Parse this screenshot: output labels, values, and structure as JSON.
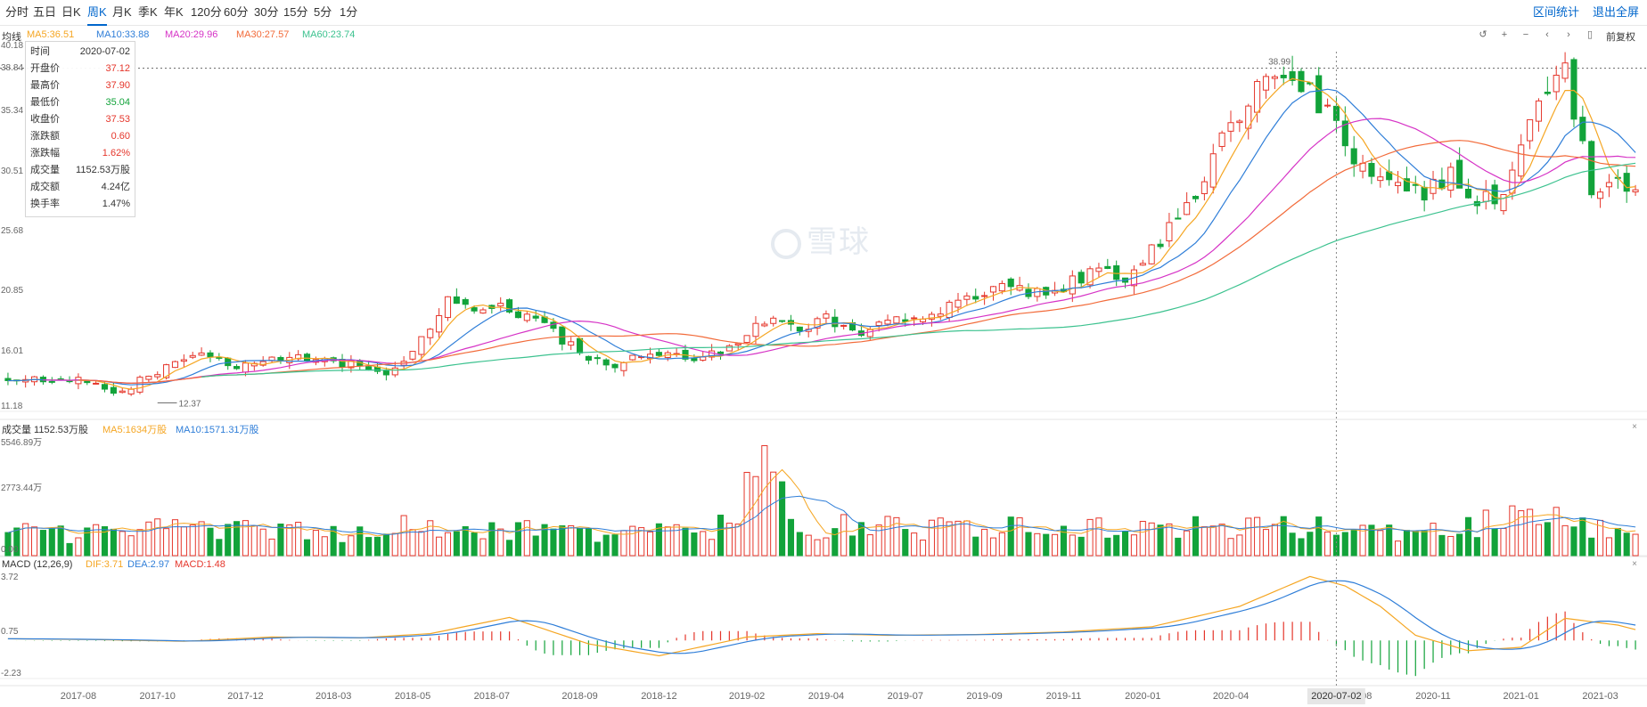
{
  "tabs": [
    {
      "label": "分时",
      "active": false
    },
    {
      "label": "五日",
      "active": false
    },
    {
      "label": "日K",
      "active": false
    },
    {
      "label": "周K",
      "active": true
    },
    {
      "label": "月K",
      "active": false
    },
    {
      "label": "季K",
      "active": false
    },
    {
      "label": "年K",
      "active": false
    },
    {
      "label": "120分",
      "active": false
    },
    {
      "label": "60分",
      "active": false
    },
    {
      "label": "30分",
      "active": false
    },
    {
      "label": "15分",
      "active": false
    },
    {
      "label": "5分",
      "active": false
    },
    {
      "label": "1分",
      "active": false
    }
  ],
  "top_links": {
    "range_stats": "区间统计",
    "exit_fullscreen": "退出全屏"
  },
  "price_legend": {
    "title": "均线",
    "items": [
      {
        "text": "MA5:36.51",
        "color": "#f5a623"
      },
      {
        "text": "MA10:33.88",
        "color": "#2f7ed8"
      },
      {
        "text": "MA20:29.96",
        "color": "#d633c6"
      },
      {
        "text": "MA30:27.57",
        "color": "#f26b3a"
      },
      {
        "text": "MA60:23.74",
        "color": "#3cc28f"
      }
    ]
  },
  "adjust_label": "前复权",
  "controls": [
    "left-right-icon",
    "zoom-in-icon",
    "zoom-out-icon",
    "prev-icon",
    "next-icon",
    "pause-icon"
  ],
  "tooltip": {
    "rows": [
      {
        "k": "时间",
        "v": "2020-07-02",
        "color": "#333333"
      },
      {
        "k": "开盘价",
        "v": "37.12",
        "color": "#e5362b"
      },
      {
        "k": "最高价",
        "v": "37.90",
        "color": "#e5362b"
      },
      {
        "k": "最低价",
        "v": "35.04",
        "color": "#12a33a"
      },
      {
        "k": "收盘价",
        "v": "37.53",
        "color": "#e5362b"
      },
      {
        "k": "涨跌额",
        "v": "0.60",
        "color": "#e5362b"
      },
      {
        "k": "涨跌幅",
        "v": "1.62%",
        "color": "#e5362b"
      },
      {
        "k": "成交量",
        "v": "1152.53万股",
        "color": "#333333"
      },
      {
        "k": "成交额",
        "v": "4.24亿",
        "color": "#333333"
      },
      {
        "k": "换手率",
        "v": "1.47%",
        "color": "#333333"
      }
    ]
  },
  "volume_legend": {
    "items": [
      {
        "text": "成交量 1152.53万股",
        "color": "#333333"
      },
      {
        "text": "MA5:1634万股",
        "color": "#f5a623"
      },
      {
        "text": "MA10:1571.31万股",
        "color": "#2f7ed8"
      }
    ]
  },
  "macd_legend": {
    "items": [
      {
        "text": "MACD (12,26,9)",
        "color": "#333333"
      },
      {
        "text": "DIF:3.71",
        "color": "#f5a623"
      },
      {
        "text": "DEA:2.97",
        "color": "#2f7ed8"
      },
      {
        "text": "MACD:1.48",
        "color": "#e5362b"
      }
    ]
  },
  "watermark": "雪球",
  "x_cursor_label": "2020-07-02",
  "chart_data": {
    "type": "candlestick",
    "colors": {
      "up": "#e5362b",
      "down": "#12a33a",
      "ma5": "#f5a623",
      "ma10": "#2f7ed8",
      "ma20": "#d633c6",
      "ma30": "#f26b3a",
      "ma60": "#3cc28f"
    },
    "x_labels": [
      "2017-08",
      "2017-10",
      "2017-12",
      "2018-03",
      "2018-05",
      "2018-07",
      "2018-09",
      "2018-12",
      "2019-02",
      "2019-04",
      "2019-07",
      "2019-09",
      "2019-11",
      "2020-01",
      "2020-04",
      "2020-08",
      "2020-11",
      "2021-01",
      "2021-03"
    ],
    "x_label_index": [
      8,
      17,
      27,
      37,
      46,
      55,
      65,
      74,
      84,
      93,
      102,
      111,
      120,
      129,
      139,
      153,
      162,
      172,
      181
    ],
    "price_axis": {
      "labels": [
        "40.18",
        "38.84",
        "35.34",
        "30.51",
        "25.68",
        "20.85",
        "16.01",
        "11.18"
      ],
      "ylim": [
        11.18,
        40.18
      ]
    },
    "annotations": [
      {
        "text": "38.99",
        "note": "period high"
      },
      {
        "text": "12.37",
        "note": "period low"
      }
    ],
    "volume_axis": {
      "labels": [
        "5546.89万",
        "2773.44万",
        "0.00"
      ],
      "ylim": [
        0,
        5546.89
      ]
    },
    "macd_axis": {
      "labels": [
        "3.72",
        "0.75",
        "-2.23"
      ],
      "ylim": [
        -2.23,
        3.72
      ]
    },
    "anchors": {
      "close_idx": [
        0,
        6,
        10,
        12,
        17,
        21,
        27,
        32,
        38,
        43,
        46,
        50,
        53,
        56,
        60,
        64,
        68,
        73,
        79,
        83,
        86,
        89,
        93,
        97,
        101,
        106,
        109,
        112,
        116,
        120,
        124,
        127,
        131,
        135,
        139,
        143,
        147,
        150,
        153,
        157,
        161,
        164,
        167,
        170,
        174,
        177,
        180,
        185
      ],
      "close_val": [
        13.4,
        14.0,
        13.2,
        12.6,
        14.3,
        15.7,
        14.8,
        15.6,
        15.0,
        14.4,
        16.2,
        20.2,
        19.0,
        19.6,
        18.4,
        16.5,
        14.6,
        15.9,
        15.4,
        17.0,
        18.6,
        17.8,
        18.6,
        17.4,
        18.6,
        19.2,
        20.3,
        21.2,
        20.7,
        21.3,
        22.6,
        21.9,
        25.0,
        28.4,
        34.6,
        38.0,
        37.5,
        35.0,
        31.8,
        29.4,
        28.5,
        30.5,
        28.2,
        28.3,
        36.8,
        38.9,
        29.0,
        29.6
      ],
      "vol_idx": [
        0,
        10,
        17,
        25,
        40,
        48,
        57,
        67,
        83,
        84,
        90,
        97,
        110,
        120,
        130,
        140,
        150,
        160,
        170,
        178,
        185
      ],
      "vol_val": [
        1100,
        1100,
        1400,
        1300,
        1100,
        1600,
        1350,
        900,
        1700,
        5500,
        1400,
        1450,
        1300,
        1400,
        1300,
        1500,
        1400,
        1100,
        1800,
        1650,
        1700
      ],
      "macd_idx": [
        0,
        10,
        20,
        30,
        40,
        48,
        57,
        66,
        74,
        84,
        92,
        100,
        110,
        120,
        130,
        140,
        148,
        152,
        156,
        160,
        166,
        172,
        177,
        183,
        186
      ],
      "macd_val": [
        0.1,
        0.05,
        -0.05,
        0.2,
        0.15,
        0.4,
        1.35,
        -0.2,
        -0.9,
        0.2,
        0.4,
        0.3,
        0.35,
        0.5,
        0.8,
        2.0,
        3.75,
        3.2,
        2.0,
        0.3,
        -0.6,
        -0.4,
        1.3,
        0.9,
        0.5
      ]
    },
    "series_count": 186
  }
}
